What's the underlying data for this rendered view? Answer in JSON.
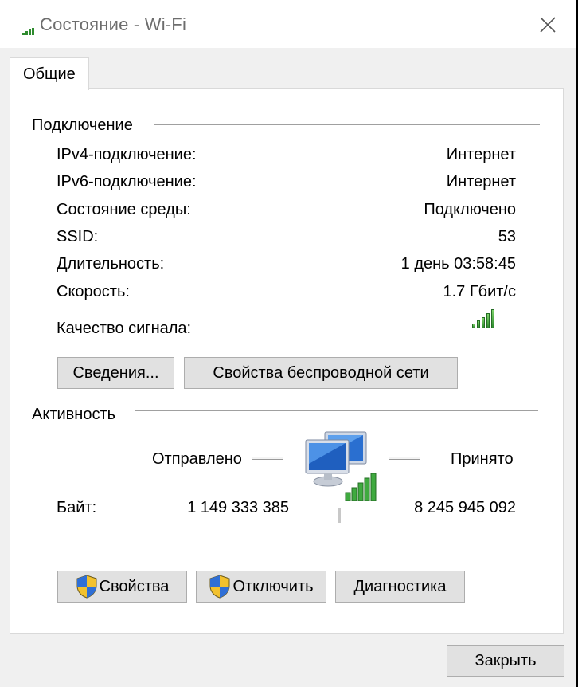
{
  "window": {
    "title": "Состояние - Wi-Fi",
    "close_label": "×"
  },
  "tabs": [
    {
      "label": "Общие"
    }
  ],
  "connection": {
    "title": "Подключение",
    "rows": [
      {
        "label": "IPv4-подключение:",
        "value": "Интернет"
      },
      {
        "label": "IPv6-подключение:",
        "value": "Интернет"
      },
      {
        "label": "Состояние среды:",
        "value": "Подключено"
      },
      {
        "label": "SSID:",
        "value": "53"
      },
      {
        "label": "Длительность:",
        "value": "1 день 03:58:45"
      },
      {
        "label": "Скорость:",
        "value": "1.7 Гбит/с"
      }
    ],
    "signal_label": "Качество сигнала:",
    "signal_level": "5/5",
    "details_button": "Сведения...",
    "wireless_props_button": "Свойства беспроводной сети"
  },
  "activity": {
    "title": "Активность",
    "sent_label": "Отправлено",
    "received_label": "Принято",
    "bytes_label": "Байт:",
    "bytes_sent": "1 149 333 385",
    "bytes_received": "8 245 945 092"
  },
  "buttons": {
    "properties": "Свойства",
    "disable": "Отключить",
    "diagnostics": "Диагностика",
    "close": "Закрыть"
  },
  "colors": {
    "signal_green": "#2e8b2e",
    "title_gray": "#6d6d6d"
  }
}
